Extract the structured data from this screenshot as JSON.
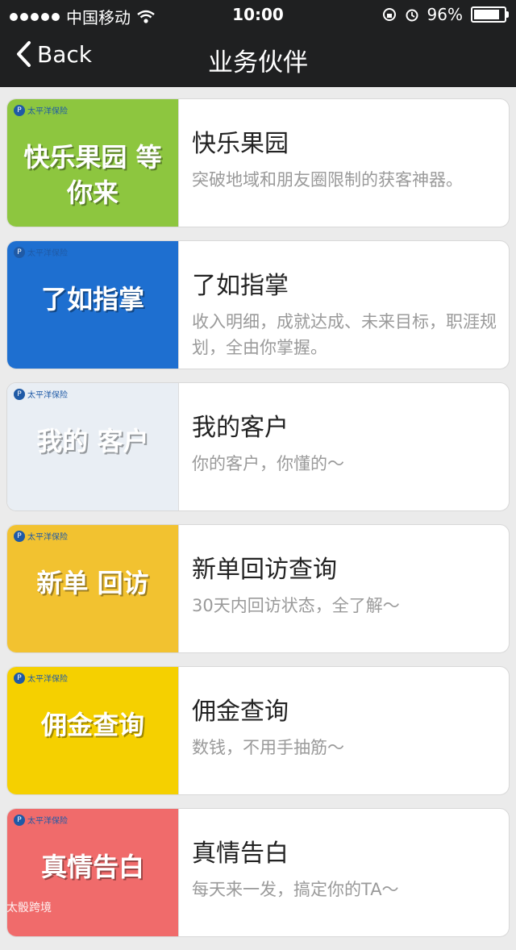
{
  "status": {
    "carrier": "中国移动",
    "time": "10:00",
    "battery": "96%",
    "battery_level": 0.96
  },
  "nav": {
    "back": "Back",
    "title": "业务伙伴"
  },
  "items": [
    {
      "title": "快乐果园",
      "desc": "突破地域和朋友圈限制的获客神器。",
      "thumb_text": "快乐果园 等你来",
      "bg": "#8dc63f"
    },
    {
      "title": "了如指掌",
      "desc": "收入明细，成就达成、未来目标，职涯规划，全由你掌握。",
      "thumb_text": "了如指掌",
      "bg": "#1e6fd0"
    },
    {
      "title": "我的客户",
      "desc": "你的客户，你懂的～",
      "thumb_text": "我的 客户",
      "bg": "#e9eef4"
    },
    {
      "title": "新单回访查询",
      "desc": "30天内回访状态，全了解～",
      "thumb_text": "新单 回访",
      "bg": "#f2c230"
    },
    {
      "title": "佣金查询",
      "desc": "数钱，不用手抽筋～",
      "thumb_text": "佣金查询",
      "bg": "#f5d000"
    },
    {
      "title": "真情告白",
      "desc": "每天来一发，搞定你的TA～",
      "thumb_text": "真情告白",
      "bg": "#f06b6b"
    }
  ],
  "brand_name": "太平洋保险",
  "watermark": "太骰跨境"
}
